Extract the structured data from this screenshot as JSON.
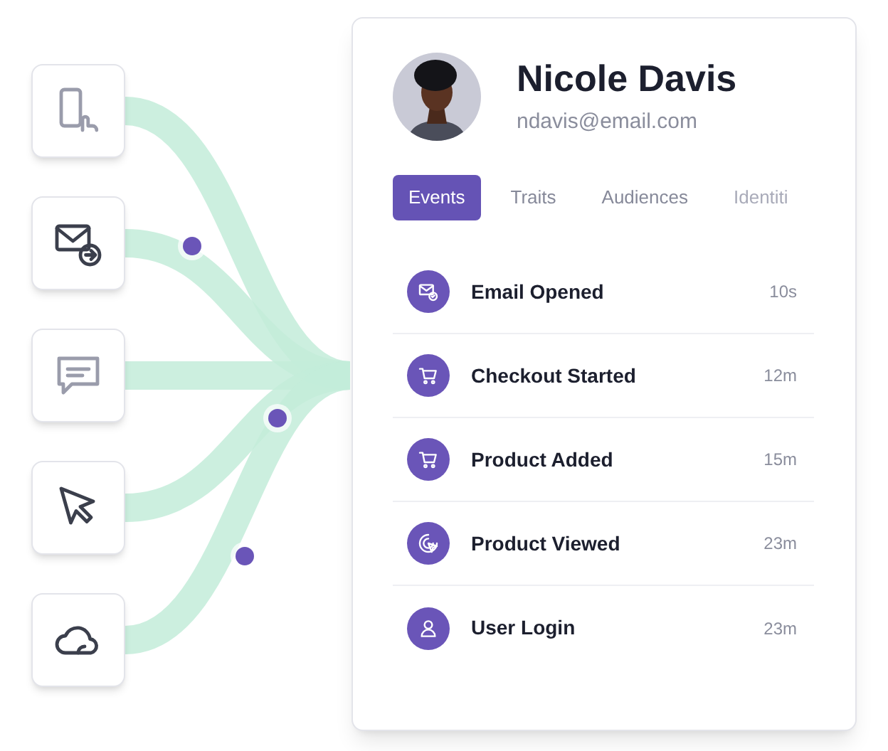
{
  "sources": [
    {
      "kind": "phone",
      "active": false
    },
    {
      "kind": "email",
      "active": true
    },
    {
      "kind": "chat",
      "active": false
    },
    {
      "kind": "cursor",
      "active": true
    },
    {
      "kind": "cloud",
      "active": true
    }
  ],
  "profile": {
    "name": "Nicole Davis",
    "email": "ndavis@email.com"
  },
  "tabs": [
    {
      "label": "Events",
      "selected": true
    },
    {
      "label": "Traits",
      "selected": false
    },
    {
      "label": "Audiences",
      "selected": false
    },
    {
      "label": "Identiti",
      "selected": false,
      "faded": true
    }
  ],
  "events": [
    {
      "kind": "email",
      "label": "Email Opened",
      "time": "10s"
    },
    {
      "kind": "cart",
      "label": "Checkout Started",
      "time": "12m"
    },
    {
      "kind": "cart",
      "label": "Product Added",
      "time": "15m"
    },
    {
      "kind": "target",
      "label": "Product Viewed",
      "time": "23m"
    },
    {
      "kind": "user",
      "label": "User Login",
      "time": "23m"
    }
  ]
}
